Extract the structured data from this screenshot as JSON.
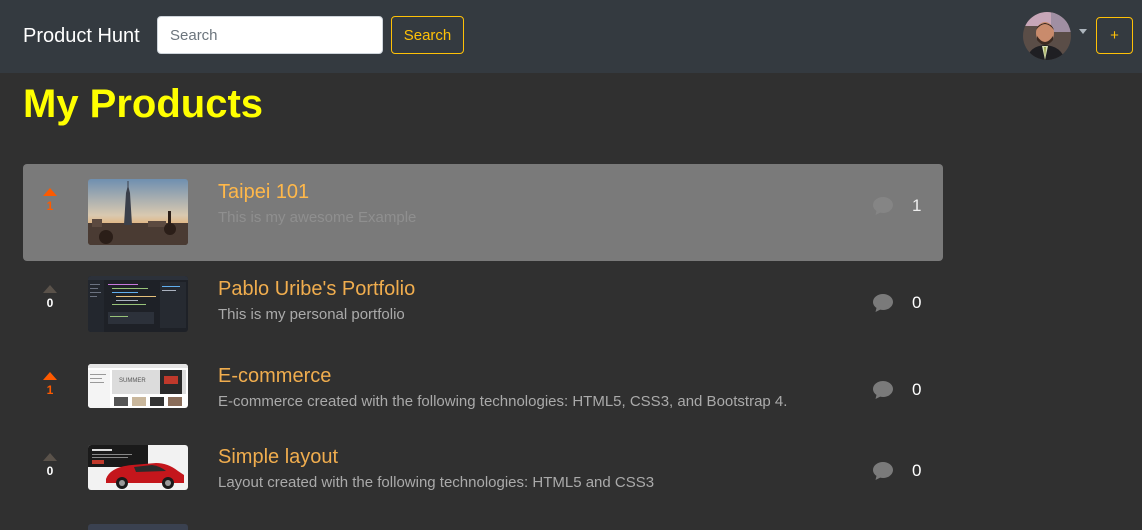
{
  "navbar": {
    "brand": "Product Hunt",
    "search_placeholder": "Search",
    "search_value": "",
    "search_button": "Search",
    "add_button": "+"
  },
  "page_title": "My Products",
  "products": [
    {
      "title": "Taipei 101",
      "description": "This is my awesome Example",
      "votes": "1",
      "voted": true,
      "comments": "1"
    },
    {
      "title": "Pablo Uribe's Portfolio",
      "description": "This is my personal portfolio",
      "votes": "0",
      "voted": false,
      "comments": "0"
    },
    {
      "title": "E-commerce",
      "description": "E-commerce created with the following technologies: HTML5, CSS3, and Bootstrap 4.",
      "votes": "1",
      "voted": true,
      "comments": "0"
    },
    {
      "title": "Simple layout",
      "description": "Layout created with the following technologies: HTML5 and CSS3",
      "votes": "0",
      "voted": false,
      "comments": "0"
    }
  ],
  "icons": {
    "vote": "upvote-triangle-icon",
    "comments": "comment-bubble-icon",
    "user_menu": "caret-down-icon"
  },
  "colors": {
    "background": "#303030",
    "navbar": "#343a40",
    "accent": "#ffc107",
    "title": "#ffff00",
    "product_title": "#f0ad4e",
    "upvoted": "#fd5a00",
    "highlight_row": "#7a7a7a"
  }
}
